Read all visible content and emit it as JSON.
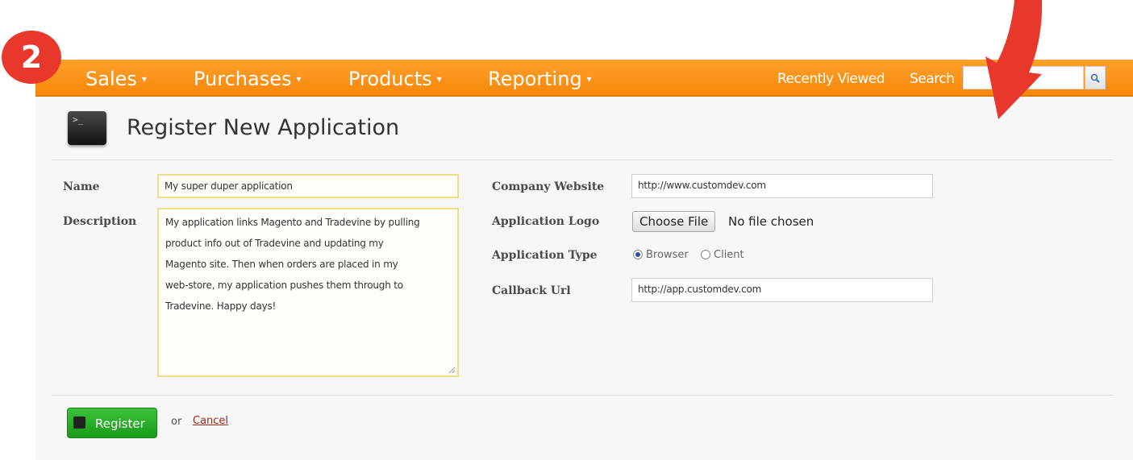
{
  "step_badge": "2",
  "nav": {
    "items": [
      {
        "label": "Sales"
      },
      {
        "label": "Purchases"
      },
      {
        "label": "Products"
      },
      {
        "label": "Reporting"
      }
    ],
    "caret": "▾",
    "recently_viewed": "Recently Viewed",
    "search_label": "Search",
    "search_value": ""
  },
  "header": {
    "title": "Register New Application",
    "icon_glyph": ">_"
  },
  "form": {
    "name_label": "Name",
    "name_value": "My super duper application",
    "description_label": "Description",
    "description_lines": [
      "My application links Magento and Tradevine by pulling",
      "product info out of Tradevine and updating my",
      "Magento site. Then when orders are placed in my",
      "web-store, my application pushes them through to",
      "Tradevine. Happy days!"
    ],
    "company_website_label": "Company Website",
    "company_website_value": "http://www.customdev.com",
    "application_logo_label": "Application Logo",
    "choose_file_label": "Choose File",
    "file_status": "No file chosen",
    "application_type_label": "Application Type",
    "type_options": [
      {
        "label": "Browser",
        "selected": true
      },
      {
        "label": "Client",
        "selected": false
      }
    ],
    "callback_url_label": "Callback Url",
    "callback_url_value": "http://app.customdev.com"
  },
  "actions": {
    "register_label": "Register",
    "or_text": "or",
    "cancel_label": "Cancel"
  },
  "colors": {
    "nav_orange": "#f6870b",
    "badge_red": "#e8382c",
    "register_green": "#1a9a1a",
    "cancel_red": "#9b2a17"
  }
}
